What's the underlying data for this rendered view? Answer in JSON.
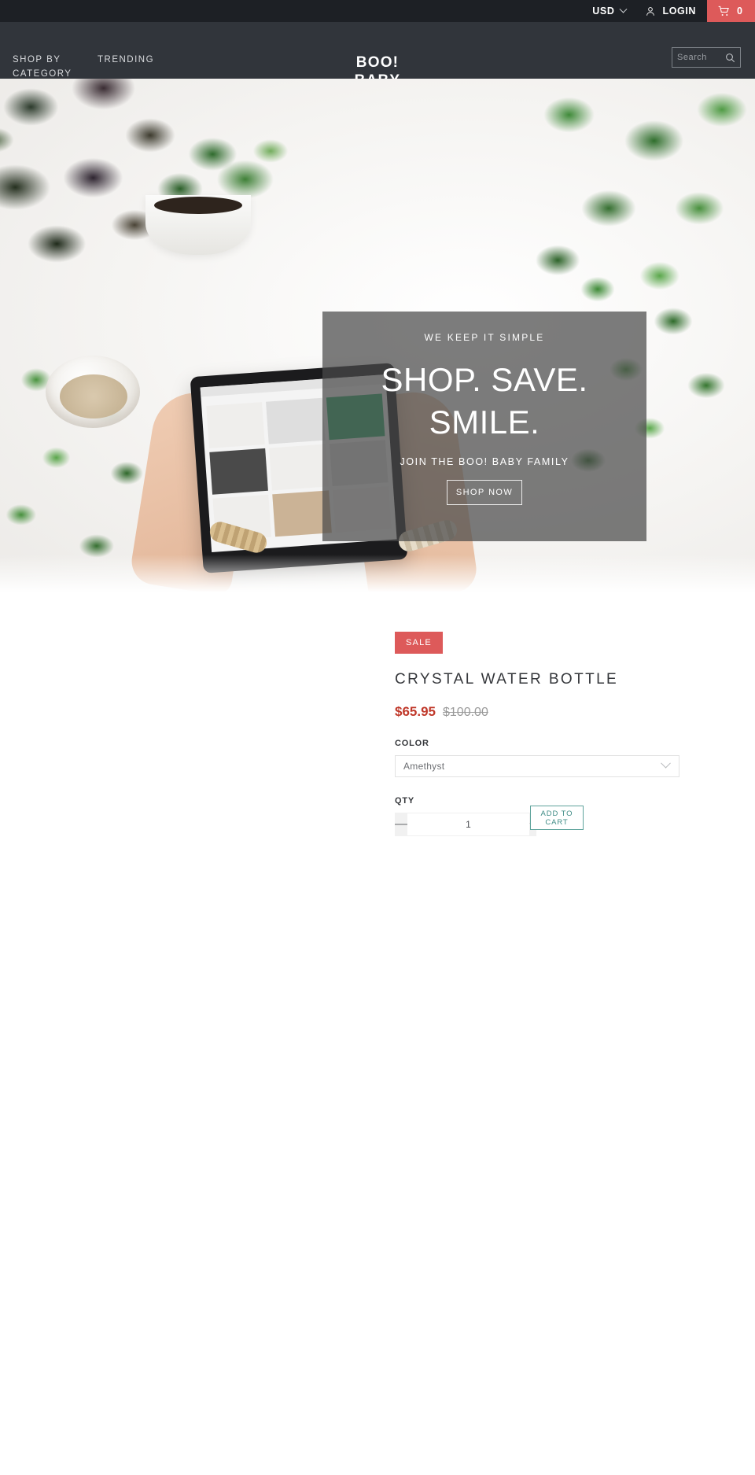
{
  "topbar": {
    "currency": "USD",
    "currency_icon": "chevron-down-icon",
    "account_icon": "person-icon",
    "login_label": "LOGIN",
    "cart_icon": "shopping-cart-icon",
    "cart_count": "0",
    "cart_color": "#dd5a5a",
    "background": "#1d2025"
  },
  "header": {
    "background": "#31353b",
    "nav": [
      {
        "label": "SHOP BY CATEGORY"
      },
      {
        "label": "TRENDING"
      }
    ],
    "brand_line_1": "BOO!",
    "brand_line_2": "BABY",
    "search": {
      "placeholder": "Search",
      "value": "",
      "icon": "search-icon"
    }
  },
  "hero": {
    "eyebrow": "WE KEEP IT SIMPLE",
    "title_line_1": "SHOP. SAVE.",
    "title_line_2": "SMILE.",
    "subtitle": "JOIN THE BOO! BABY FAMILY",
    "cta_line_1": "SHOP",
    "cta_line_2": "NOW",
    "overlay_color": "rgba(74,74,74,0.72)"
  },
  "product": {
    "badge": "SALE",
    "badge_color": "#dd5a5a",
    "title": "CRYSTAL WATER BOTTLE",
    "price_sale": "$65.95",
    "price_sale_color": "#c0392b",
    "price_compare": "$100.00",
    "color_label": "COLOR",
    "color_selected": "Amethyst",
    "color_chevron_icon": "chevron-down-icon",
    "qty_label": "QTY",
    "qty_value": "1",
    "qty_decrease_icon": "minus-icon",
    "qty_increase_icon": "plus-icon",
    "add_to_cart_line_1": "ADD TO",
    "add_to_cart_line_2": "CART",
    "add_to_cart_color": "#3f8c86"
  }
}
